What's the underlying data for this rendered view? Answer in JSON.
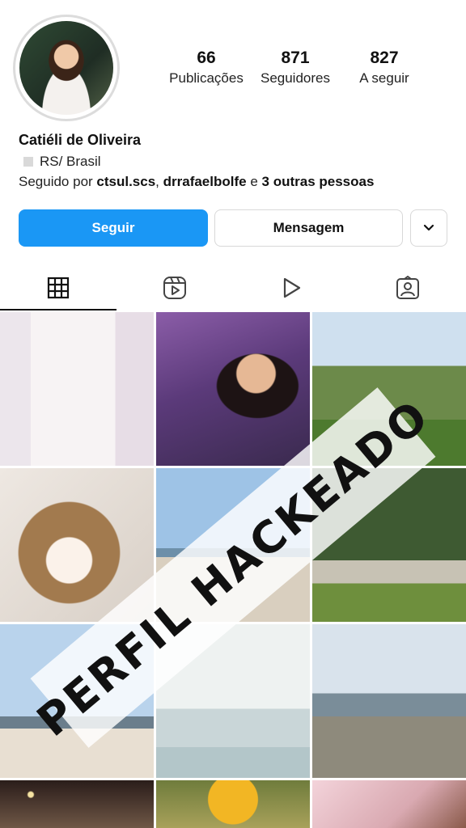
{
  "profile": {
    "name": "Catiéli de Oliveira",
    "location": "RS/ Brasil",
    "followed_prefix": "Seguido por ",
    "followed_user1": "ctsul.scs",
    "followed_sep": ", ",
    "followed_user2": "drrafaelbolfe",
    "followed_and": " e ",
    "followed_others": "3 outras pessoas"
  },
  "stats": [
    {
      "value": "66",
      "label": "Publicações"
    },
    {
      "value": "871",
      "label": "Seguidores"
    },
    {
      "value": "827",
      "label": "A seguir"
    }
  ],
  "buttons": {
    "follow": "Seguir",
    "message": "Mensagem",
    "more_icon": "chevron-down-icon"
  },
  "tabs": [
    {
      "icon": "grid-icon",
      "active": true
    },
    {
      "icon": "reels-icon",
      "active": false
    },
    {
      "icon": "play-icon",
      "active": false
    },
    {
      "icon": "tagged-icon",
      "active": false
    }
  ],
  "overlay": {
    "text": "PERFIL HACKEADO"
  },
  "colors": {
    "accent": "#1a97f5"
  }
}
